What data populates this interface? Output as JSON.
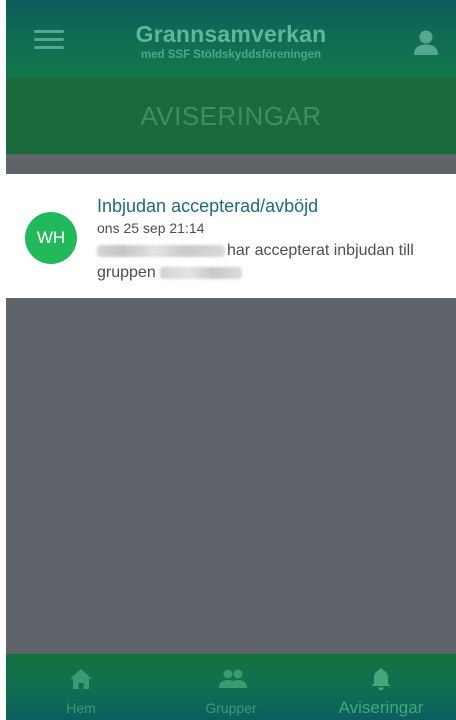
{
  "header": {
    "title": "Grannsamverkan",
    "subtitle": "med SSF Stöldskyddsföreningen"
  },
  "section": {
    "title": "AVISERINGAR"
  },
  "notifications": [
    {
      "avatar_initials": "WH",
      "title": "Inbjudan accepterad/avböjd",
      "time": "ons 25 sep 21:14",
      "body_text": "har accepterat inbjudan till gruppen",
      "body_prefix_text": "har accepterat inbjudan till",
      "body_suffix_text": "gruppen"
    }
  ],
  "bottom_nav": {
    "items": [
      {
        "label": "Hem",
        "icon": "home-icon"
      },
      {
        "label": "Grupper",
        "icon": "group-icon"
      },
      {
        "label": "Aviseringar",
        "icon": "bell-icon",
        "active": true
      }
    ]
  },
  "colors": {
    "header_start": "#0c5b5c",
    "header_end": "#13774a",
    "section_bg": "#1b6a3b",
    "overlay": "#5e6469",
    "avatar": "#22b85c",
    "notif_title": "#1d6a82"
  }
}
